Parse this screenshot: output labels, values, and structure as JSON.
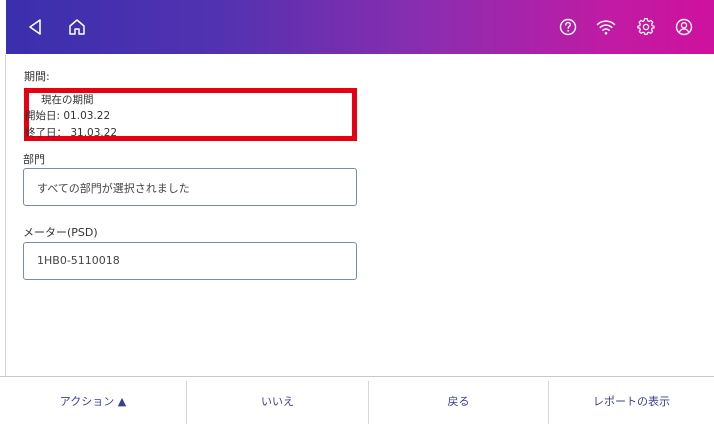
{
  "header": {
    "icons": [
      "back-icon",
      "home-icon",
      "help-icon",
      "wifi-icon",
      "settings-icon",
      "account-icon"
    ]
  },
  "period": {
    "label": "期間:",
    "current": "現在の期間",
    "start": "開始日: 01.03.22",
    "end": "終了日： 31.03.22"
  },
  "department": {
    "label": "部門",
    "value": "すべての部門が選択されました"
  },
  "meter": {
    "label": "メーター(PSD)",
    "value": "1HB0-5110018"
  },
  "bottom_bar": {
    "action": "アクション ▲",
    "no": "いいえ",
    "back": "戻る",
    "show_report": "レポートの表示"
  },
  "colors": {
    "gradient_start": "#3a2fae",
    "gradient_end": "#cf119e",
    "highlight": "#e60012",
    "button_text": "#3b3f8f"
  }
}
